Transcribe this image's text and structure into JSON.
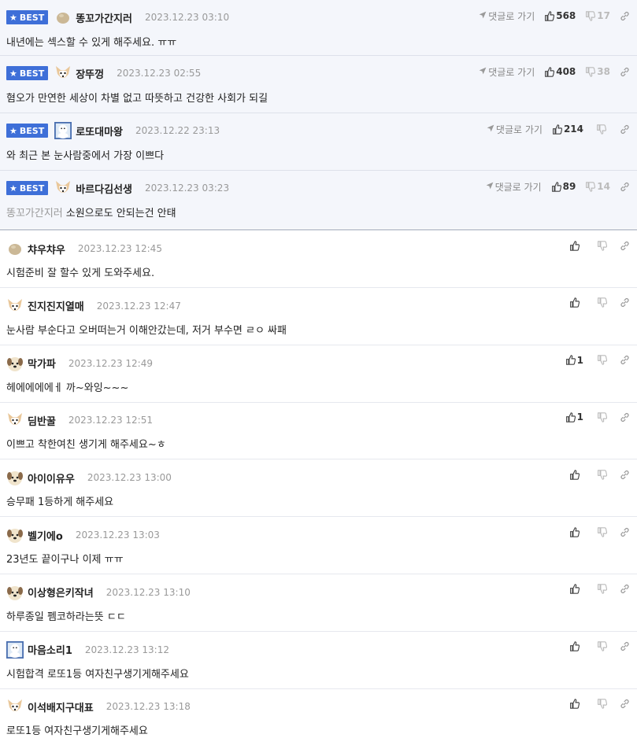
{
  "best_badge": "BEST",
  "goto_label": "댓글로 가기",
  "best_comments": [
    {
      "nick": "똥꼬가간지러",
      "date": "2023.12.23 03:10",
      "text": "내년에는 섹스할 수 있게 해주세요. ㅠㅠ",
      "mention": "",
      "up": "568",
      "down": "17",
      "avatar": "bean"
    },
    {
      "nick": "장뚜껑",
      "date": "2023.12.23 02:55",
      "text": "혐오가 만연한 세상이 차별 없고 따뜻하고 건강한 사회가 되길",
      "mention": "",
      "up": "408",
      "down": "38",
      "avatar": "dog-white"
    },
    {
      "nick": "로또대마왕",
      "date": "2023.12.22 23:13",
      "text": "와 최근 본 눈사람중에서 가장 이쁘다",
      "mention": "",
      "up": "214",
      "down": "",
      "avatar": "custom"
    },
    {
      "nick": "바르다김선생",
      "date": "2023.12.23 03:23",
      "text": "소원으로도 안되는건 안턔",
      "mention": "똥꼬가간지러",
      "up": "89",
      "down": "14",
      "avatar": "dog-white"
    }
  ],
  "comments": [
    {
      "nick": "챠우챠우",
      "date": "2023.12.23 12:45",
      "text": "시험준비 잘 할수 있게 도와주세요.",
      "up": "",
      "avatar": "bean"
    },
    {
      "nick": "진지진지열매",
      "date": "2023.12.23 12:47",
      "text": "눈사람 부순다고 오버떠는거 이해안갔는데, 저거 부수면 ㄹㅇ 싸패",
      "up": "",
      "avatar": "dog-white"
    },
    {
      "nick": "막가파",
      "date": "2023.12.23 12:49",
      "text": "헤에에에에ㅔ 까~와잉~~~",
      "up": "1",
      "avatar": "dog-round"
    },
    {
      "nick": "딤반꿀",
      "date": "2023.12.23 12:51",
      "text": "이쁘고 착한여친 생기게 해주세요~ㅎ",
      "up": "1",
      "avatar": "dog-white"
    },
    {
      "nick": "아이이유우",
      "date": "2023.12.23 13:00",
      "text": "승무패 1등하게 해주세요",
      "up": "",
      "avatar": "dog-round"
    },
    {
      "nick": "벨기에o",
      "date": "2023.12.23 13:03",
      "text": "23년도 끝이구나 이제 ㅠㅠ",
      "up": "",
      "avatar": "dog-round"
    },
    {
      "nick": "이상형은키작녀",
      "date": "2023.12.23 13:10",
      "text": "하루종일 펨코하라는뜻 ㄷㄷ",
      "up": "",
      "avatar": "dog-round"
    },
    {
      "nick": "마음소리1",
      "date": "2023.12.23 13:12",
      "text": "시험합격 로또1등 여자친구생기게해주세요",
      "up": "",
      "avatar": "custom"
    },
    {
      "nick": "이석배지구대표",
      "date": "2023.12.23 13:18",
      "text": "로또1등 여자친구생기게해주세요",
      "up": "",
      "avatar": "dog-white"
    }
  ],
  "colors": {
    "badge": "#3e6fd8",
    "best_bg": "#f4f6fb"
  }
}
